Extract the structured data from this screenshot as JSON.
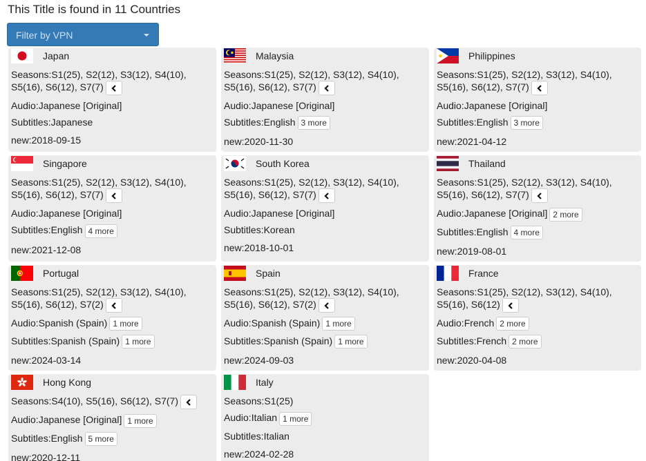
{
  "page_title": "This Title is found in 11 Countries",
  "filter": {
    "label": "Filter by VPN"
  },
  "labels": {
    "seasons": "Seasons:",
    "audio": "Audio:",
    "subtitles": "Subtitles:",
    "new": "new:"
  },
  "countries": [
    {
      "name": "Japan",
      "seasons_line1": "S1(25), S2(12), S3(12), S4(10),",
      "seasons_line2": "S5(16), S6(12), S7(7)",
      "audio": "Japanese [Original]",
      "audio_more": "",
      "subtitles": "Japanese",
      "subtitles_more": "",
      "new": "2018-09-15"
    },
    {
      "name": "Malaysia",
      "seasons_line1": "S1(25), S2(12), S3(12), S4(10),",
      "seasons_line2": "S5(16), S6(12), S7(7)",
      "audio": "Japanese [Original]",
      "audio_more": "",
      "subtitles": "English",
      "subtitles_more": "3 more",
      "new": "2020-11-30"
    },
    {
      "name": "Philippines",
      "seasons_line1": "S1(25), S2(12), S3(12), S4(10),",
      "seasons_line2": "S5(16), S6(12), S7(7)",
      "audio": "Japanese [Original]",
      "audio_more": "",
      "subtitles": "English",
      "subtitles_more": "3 more",
      "new": "2021-04-12"
    },
    {
      "name": "Singapore",
      "seasons_line1": "S1(25), S2(12), S3(12), S4(10),",
      "seasons_line2": "S5(16), S6(12), S7(7)",
      "audio": "Japanese [Original]",
      "audio_more": "",
      "subtitles": "English",
      "subtitles_more": "4 more",
      "new": "2021-12-08"
    },
    {
      "name": "South Korea",
      "seasons_line1": "S1(25), S2(12), S3(12), S4(10),",
      "seasons_line2": "S5(16), S6(12), S7(7)",
      "audio": "Japanese [Original]",
      "audio_more": "",
      "subtitles": "Korean",
      "subtitles_more": "",
      "new": "2018-10-01"
    },
    {
      "name": "Thailand",
      "seasons_line1": "S1(25), S2(12), S3(12), S4(10),",
      "seasons_line2": "S5(16), S6(12), S7(7)",
      "audio": "Japanese [Original]",
      "audio_more": "2 more",
      "subtitles": "English",
      "subtitles_more": "4 more",
      "new": "2019-08-01"
    },
    {
      "name": "Portugal",
      "seasons_line1": "S1(25), S2(12), S3(12), S4(10),",
      "seasons_line2": "S5(16), S6(12), S7(2)",
      "audio": "Spanish (Spain)",
      "audio_more": "1 more",
      "subtitles": "Spanish (Spain)",
      "subtitles_more": "1 more",
      "new": "2024-03-14"
    },
    {
      "name": "Spain",
      "seasons_line1": "S1(25), S2(12), S3(12), S4(10),",
      "seasons_line2": "S5(16), S6(12), S7(2)",
      "audio": "Spanish (Spain)",
      "audio_more": "1 more",
      "subtitles": "Spanish (Spain)",
      "subtitles_more": "1 more",
      "new": "2024-09-03"
    },
    {
      "name": "France",
      "seasons_line1": "S1(25), S2(12), S3(12), S4(10),",
      "seasons_line2": "S5(16), S6(12)",
      "audio": "French",
      "audio_more": "2 more",
      "subtitles": "French",
      "subtitles_more": "2 more",
      "new": "2020-04-08"
    },
    {
      "name": "Hong Kong",
      "seasons_line1": "",
      "seasons_line2": "S4(10), S5(16), S6(12), S7(7)",
      "audio": "Japanese [Original]",
      "audio_more": "1 more",
      "subtitles": "English",
      "subtitles_more": "5 more",
      "new": "2020-12-11"
    },
    {
      "name": "Italy",
      "seasons_line1": "",
      "seasons_line2": "S1(25)",
      "audio": "Italian",
      "audio_more": "1 more",
      "subtitles": "Italian",
      "subtitles_more": "",
      "new": "2024-02-28",
      "no_chevron": true
    }
  ]
}
